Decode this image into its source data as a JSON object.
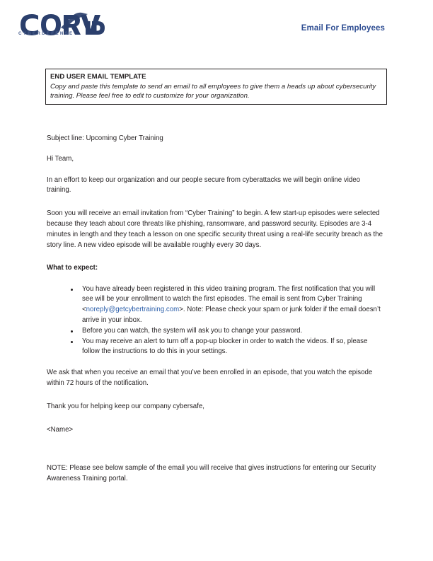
{
  "header": {
    "logo": {
      "wordmark": "CORVID",
      "tagline": "CYBERDEFENSE",
      "primary_color": "#2b3f6c",
      "tagline_color": "#4a5f8e"
    },
    "title": "Email For Employees",
    "title_color": "#2e4d92"
  },
  "template_box": {
    "title": "END USER EMAIL TEMPLATE",
    "description": "Copy and paste this template to send an email to all employees to give them a heads up about cybersecurity training. Please feel free to edit to customize for your organization.",
    "border_color": "#231f20"
  },
  "email": {
    "subject_line": "Subject line: Upcoming Cyber Training",
    "greeting": "Hi Team,",
    "intro": "In an effort to keep our organization and our people secure from cyberattacks we will begin online video training.",
    "episodes_paragraph": "Soon you will receive an email invitation from “Cyber Training” to begin. A few start-up episodes were selected because they teach about core threats like phishing, ransomware, and password security. Episodes are 3-4 minutes in length and they teach a lesson on one specific security threat using a real-life security breach as the story line. A new video episode will be available roughly every 30 days.",
    "expect_heading": "What to expect:",
    "bullets": [
      {
        "text_before_link": "You have already been registered in this video training program. The first notification that you will see will be your enrollment to watch the first episodes. The email is sent from Cyber Training <",
        "link": "noreply@getcybertraining.com",
        "link_color": "#2c5faa",
        "text_after_link": ">. Note: Please check your spam or junk folder if the email doesn’t arrive in your inbox."
      },
      {
        "text_before_link": "Before you can watch, the system will ask you to change your password.",
        "link": "",
        "text_after_link": ""
      },
      {
        "text_before_link": "You may receive an alert to turn off a pop-up blocker in order to watch the videos. If so, please follow the instructions to do this in your settings.",
        "link": "",
        "text_after_link": ""
      }
    ],
    "ask_paragraph": "We ask that when you receive an email that you’ve been enrolled in an episode, that you watch the episode within 72 hours of the notification.",
    "closing": "Thank you for helping keep our company cybersafe,",
    "signature": "<Name>",
    "note": "NOTE: Please see below sample of the email you will receive that gives instructions for entering our Security Awareness Training portal."
  }
}
